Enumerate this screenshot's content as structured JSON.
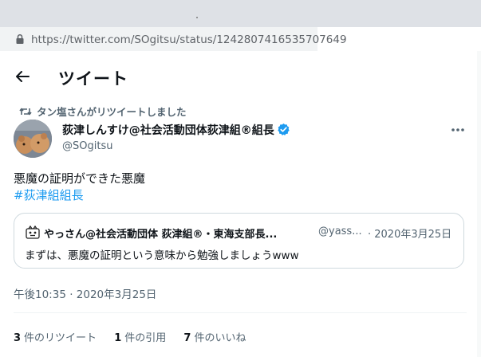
{
  "browser": {
    "url_host": "https://twitter.com",
    "url_path": "/SOgitsu/status/1242807416535707649"
  },
  "header": {
    "title": "ツイート"
  },
  "retweet_context": {
    "text": "タン塩さんがリツイートしました"
  },
  "author": {
    "name": "荻津しんすけ@社会活動団体荻津組®組長",
    "handle": "@SOgitsu"
  },
  "tweet": {
    "text": "悪魔の証明ができた悪魔",
    "hashtag": "#荻津組組長",
    "timestamp": "午後10:35 · 2020年3月25日"
  },
  "quote": {
    "name": "やっさん@社会活動団体 荻津組®・東海支部長...",
    "handle": "@yass...",
    "date": "· 2020年3月25日",
    "text": "まずは、悪魔の証明という意味から勉強しましょうwww"
  },
  "stats": {
    "retweets_count": "3",
    "retweets_label": "件のリツイート",
    "quotes_count": "1",
    "quotes_label": "件の引用",
    "likes_count": "7",
    "likes_label": "件のいいね"
  },
  "colors": {
    "accent": "#1d9bf0",
    "secondary_text": "#536471",
    "border": "#cfd9de"
  },
  "icons": [
    "lock-icon",
    "back-arrow-icon",
    "retweet-icon",
    "verified-badge-icon",
    "more-icon"
  ]
}
